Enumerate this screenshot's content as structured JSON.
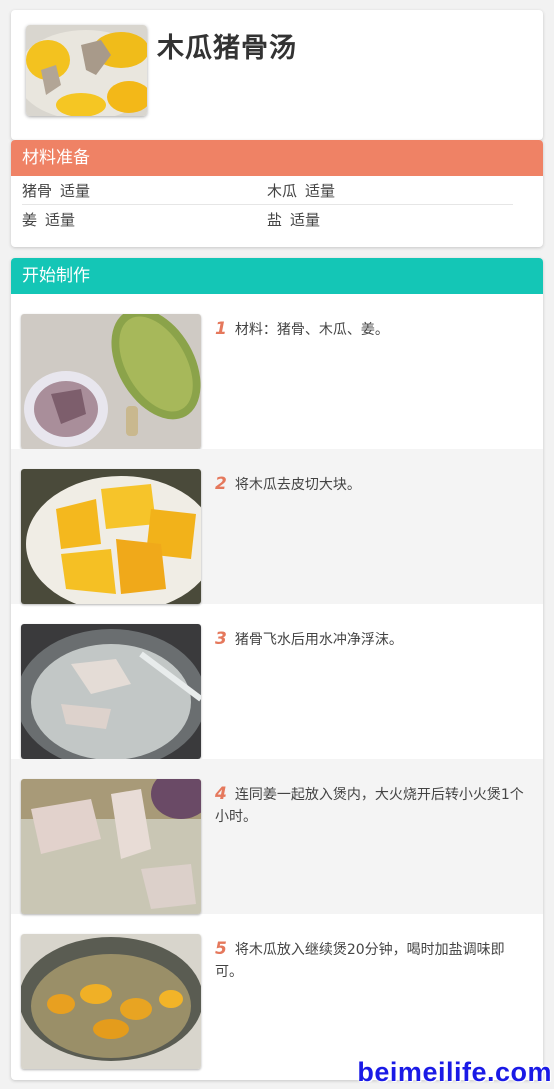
{
  "recipe": {
    "title": "木瓜猪骨汤"
  },
  "ingredients": {
    "header": "材料准备",
    "header_color": "#ef8265",
    "items": [
      {
        "name": "猪骨",
        "amount": "适量"
      },
      {
        "name": "木瓜",
        "amount": "适量"
      },
      {
        "name": "姜",
        "amount": "适量"
      },
      {
        "name": "盐",
        "amount": "适量"
      }
    ]
  },
  "steps": {
    "header": "开始制作",
    "header_color": "#14c6b6",
    "items": [
      {
        "number": "1",
        "text": "材料：猪骨、木瓜、姜。"
      },
      {
        "number": "2",
        "text": "将木瓜去皮切大块。"
      },
      {
        "number": "3",
        "text": "猪骨飞水后用水冲净浮沫。"
      },
      {
        "number": "4",
        "text": "连同姜一起放入煲内，大火烧开后转小火煲1个小时。"
      },
      {
        "number": "5",
        "text": "将木瓜放入继续煲20分钟，喝时加盐调味即可。"
      }
    ]
  },
  "watermark": "beimeilife.com",
  "colors": {
    "step_number": "#e5785c",
    "watermark": "#1a1ae6"
  }
}
